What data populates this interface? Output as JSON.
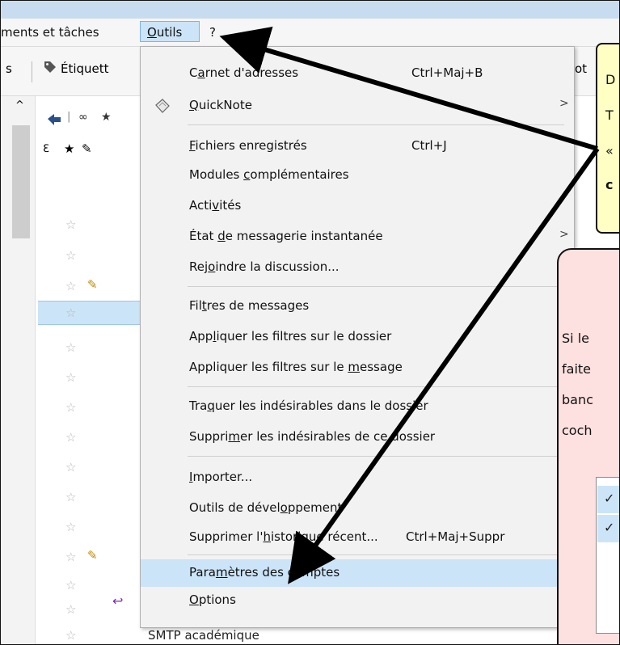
{
  "menubar": {
    "item_left": "ments et tâches",
    "outils_u": "O",
    "outils_rest": "utils",
    "help": "?"
  },
  "toolbar": {
    "left_label": "s",
    "tags_label": "Étiquett",
    "right_fragment": "ot"
  },
  "list": {
    "bottom_text": "SMTP académique"
  },
  "menu": {
    "carnet": {
      "pre": "C",
      "u": "a",
      "post": "rnet d'adresses",
      "shortcut": "Ctrl+Maj+B"
    },
    "quicknote": {
      "pre": "",
      "u": "Q",
      "post": "uickNote"
    },
    "fichiers": {
      "pre": "",
      "u": "F",
      "post": "ichiers enregistrés",
      "shortcut": "Ctrl+J"
    },
    "modules": {
      "pre": "Modules ",
      "u": "c",
      "post": "omplémentaires"
    },
    "activites": {
      "pre": "Acti",
      "u": "v",
      "post": "ités"
    },
    "etat": {
      "pre": "État ",
      "u": "d",
      "post": "e messagerie instantanée"
    },
    "rejoindre": {
      "pre": "Rej",
      "u": "o",
      "post": "indre la discussion..."
    },
    "filtres": {
      "pre": "Fil",
      "u": "t",
      "post": "res de messages"
    },
    "appliquer_dossier": {
      "pre": "App",
      "u": "l",
      "post": "iquer les filtres sur le dossier"
    },
    "appliquer_message": {
      "pre": "Appliquer les filtres sur le ",
      "u": "m",
      "post": "essage"
    },
    "traquer": {
      "pre": "Tra",
      "u": "q",
      "post": "uer les indésirables dans le dossier"
    },
    "supprimer_indes": {
      "pre": "Suppri",
      "u": "m",
      "post": "er les indésirables de ce dossier"
    },
    "importer": {
      "pre": "",
      "u": "I",
      "post": "mporter..."
    },
    "outils_dev": {
      "pre": "Outils de dével",
      "u": "o",
      "post": "ppement"
    },
    "historique": {
      "pre": "Supprimer l'",
      "u": "h",
      "post": "istorique récent...",
      "shortcut": "Ctrl+Maj+Suppr"
    },
    "parametres": {
      "pre": "Para",
      "u": "m",
      "post": "ètres des comptes"
    },
    "options": {
      "pre": "",
      "u": "O",
      "post": "ptions"
    }
  },
  "note_yellow": {
    "line1": "D",
    "line2": "T",
    "line3": "«",
    "line4": "c"
  },
  "note_pink": {
    "line1": "Si le",
    "line2": "faite",
    "line3": "banc",
    "line4": "coch"
  },
  "checks": {
    "mark": "✓"
  },
  "colors": {
    "accent": "#cce4f7",
    "note_yellow": "#ffffc4",
    "note_pink": "#fde0e0"
  }
}
